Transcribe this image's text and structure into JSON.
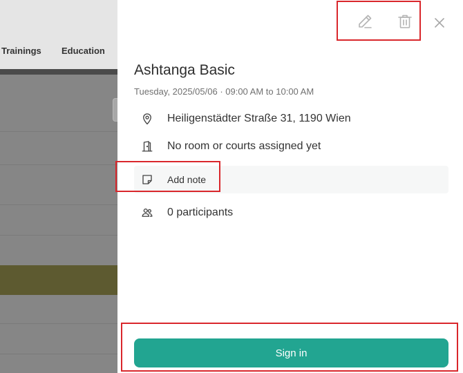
{
  "background": {
    "nav": [
      "Trainings",
      "Education"
    ]
  },
  "event": {
    "title": "Ashtanga Basic",
    "datetime": "Tuesday, 2025/05/06 · 09:00 AM to 10:00 AM",
    "location": "Heiligenstädter Straße 31, 1190 Wien",
    "room": "No room or courts assigned yet",
    "note_label": "Add note",
    "participants": "0 participants"
  },
  "actions": {
    "edit_icon": "pencil-icon",
    "delete_icon": "trash-icon",
    "close_icon": "close-icon",
    "signin_label": "Sign in"
  },
  "colors": {
    "accent": "#22a591",
    "highlight": "#d9262b"
  }
}
